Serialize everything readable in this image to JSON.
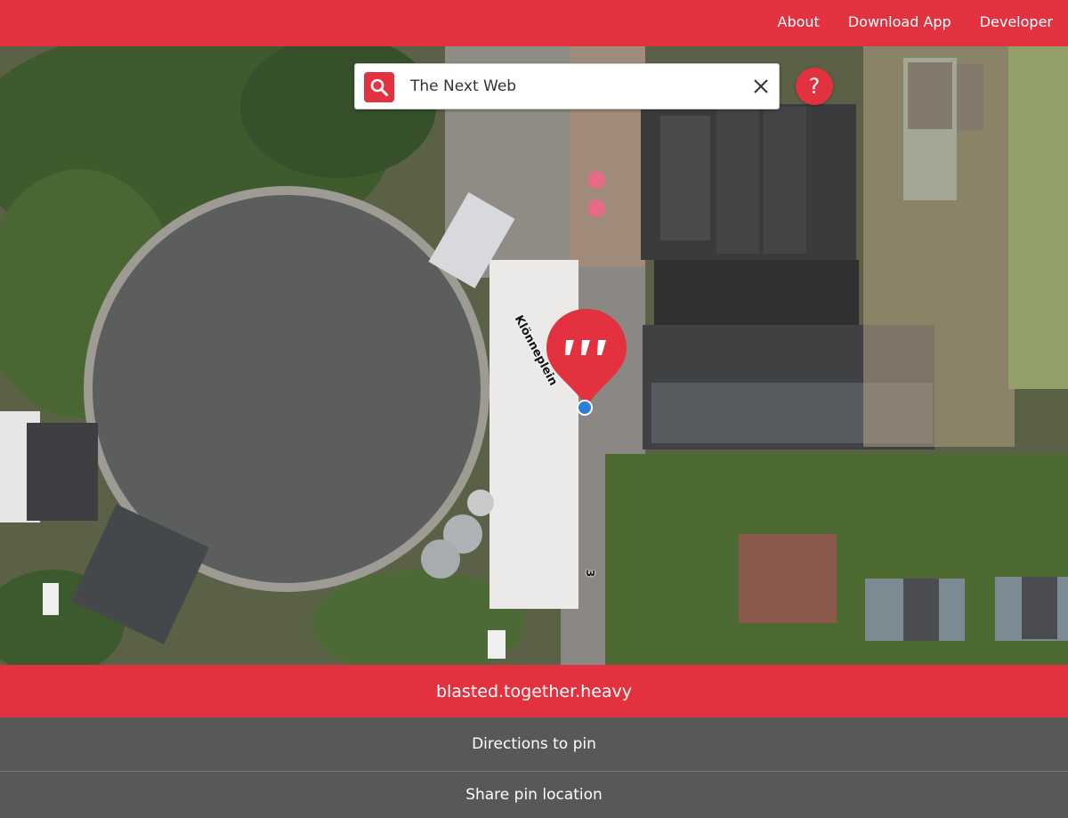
{
  "nav": {
    "items": [
      "About",
      "Download App",
      "Developer"
    ]
  },
  "search": {
    "value": "The Next Web",
    "placeholder": ""
  },
  "help": {
    "label": "?"
  },
  "map": {
    "street_label": "Klönneplein",
    "house_number": "3"
  },
  "pin": {
    "words": "blasted.together.heavy"
  },
  "actions": {
    "directions": "Directions to pin",
    "share": "Share pin location"
  },
  "colors": {
    "brand": "#e2323f",
    "action_bg": "#58585a",
    "location_dot": "#2a7fd6"
  },
  "icons": {
    "search": "search-icon",
    "clear": "close-icon",
    "pin": "map-pin-icon"
  }
}
